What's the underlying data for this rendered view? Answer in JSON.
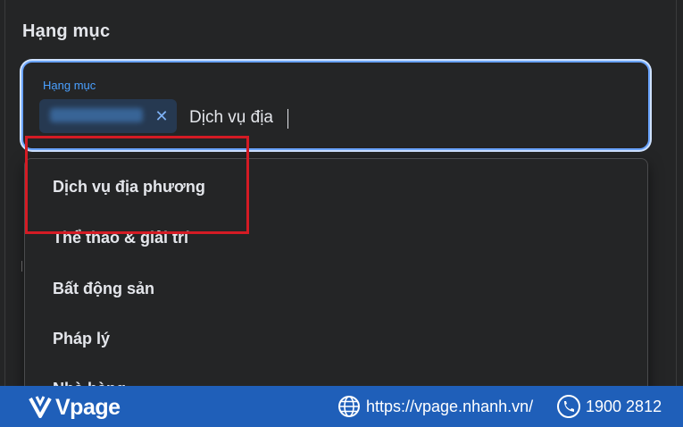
{
  "section": {
    "title": "Hạng mục"
  },
  "field": {
    "label": "Hạng mục",
    "chip_close": "✕",
    "input_value": "Dịch vụ địa"
  },
  "dropdown": {
    "options": [
      "Dịch vụ địa phương",
      "Thể thao & giải trí",
      "Bất động sản",
      "Pháp lý",
      "Nhà hàng"
    ]
  },
  "footer": {
    "brand": "Vpage",
    "url": "https://vpage.nhanh.vn/",
    "phone": "1900 2812"
  },
  "colors": {
    "background": "#242526",
    "focus_border": "#6aa4ff",
    "highlight": "#d41b24",
    "footer": "#1f5fb9"
  },
  "icons": [
    "close-icon",
    "vpage-logo-icon",
    "globe-icon",
    "phone-icon"
  ]
}
